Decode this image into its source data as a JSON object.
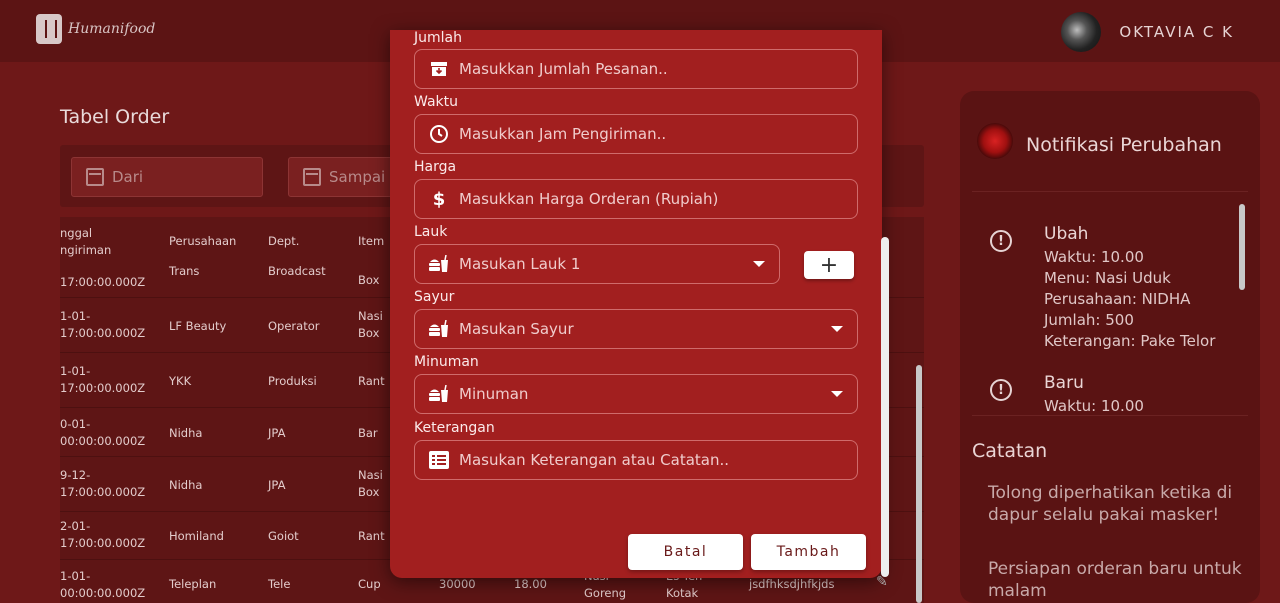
{
  "app": {
    "name": "Humanifood"
  },
  "user": {
    "name": "OKTAVIA C K"
  },
  "page": {
    "title": "Tabel Order"
  },
  "filters": {
    "from_placeholder": "Dari",
    "to_placeholder": "Sampai"
  },
  "table": {
    "headers": [
      "nggal\nngiriman",
      "Perusahaan",
      "Dept.",
      "Item"
    ],
    "rows": [
      {
        "tanggal": "17:00:00.000Z",
        "perusahaan": "Trans",
        "dept": "Broadcast",
        "item": "Box"
      },
      {
        "tanggal": "1-01-\n17:00:00.000Z",
        "perusahaan": "LF Beauty",
        "dept": "Operator",
        "item": "Nasi\nBox"
      },
      {
        "tanggal": "1-01-\n17:00:00.000Z",
        "perusahaan": "YKK",
        "dept": "Produksi",
        "item": "Rant"
      },
      {
        "tanggal": "0-01-\n00:00:00.000Z",
        "perusahaan": "Nidha",
        "dept": "JPA",
        "item": "Bar"
      },
      {
        "tanggal": "9-12-\n17:00:00.000Z",
        "perusahaan": "Nidha",
        "dept": "JPA",
        "item": "Nasi\nBox"
      },
      {
        "tanggal": "2-01-\n17:00:00.000Z",
        "perusahaan": "Homiland",
        "dept": "Goiot",
        "item": "Rant"
      },
      {
        "tanggal": "1-01-\n00:00:00.000Z",
        "perusahaan": "Teleplan",
        "dept": "Tele",
        "item": "Cup",
        "jumlah": "30000",
        "waktu": "18.00",
        "menu": "Nasi\nGoreng",
        "lauk": "Es Teh\nKotak",
        "ket": "jsdfhksdjhfkjds"
      }
    ]
  },
  "modal": {
    "fields": [
      {
        "label": "Jumlah",
        "placeholder": "Masukkan Jumlah Pesanan..",
        "icon": "archive-icon"
      },
      {
        "label": "Waktu",
        "placeholder": "Masukkan Jam Pengiriman..",
        "icon": "clock-icon"
      },
      {
        "label": "Harga",
        "placeholder": "Masukkan Harga Orderan (Rupiah)",
        "icon": "dollar-icon"
      },
      {
        "label": "Lauk",
        "placeholder": "Masukan Lauk 1",
        "icon": "food-icon"
      },
      {
        "label": "Sayur",
        "placeholder": "Masukan Sayur",
        "icon": "food-icon"
      },
      {
        "label": "Minuman",
        "placeholder": "Minuman",
        "icon": "food-icon"
      },
      {
        "label": "Keterangan",
        "placeholder": "Masukan Keterangan atau Catatan..",
        "icon": "list-icon"
      }
    ],
    "plus_label": "+",
    "cancel_label": "Batal",
    "add_label": "Tambah"
  },
  "notifications": {
    "title": "Notifikasi Perubahan",
    "items": [
      {
        "type": "Ubah",
        "lines": [
          "Waktu: 10.00",
          "Menu: Nasi Uduk",
          "Perusahaan: NIDHA",
          "Jumlah: 500",
          "Keterangan: Pake Telor"
        ]
      },
      {
        "type": "Baru",
        "lines": [
          "Waktu: 10.00"
        ]
      }
    ]
  },
  "catatan": {
    "title": "Catatan",
    "notes": [
      "Tolong diperhatikan ketika di dapur selalu pakai masker!",
      "Persiapan orderan baru untuk malam"
    ]
  },
  "colors": {
    "primary": "#a21f1f",
    "background": "#6e1818",
    "panel": "#5a1313"
  }
}
